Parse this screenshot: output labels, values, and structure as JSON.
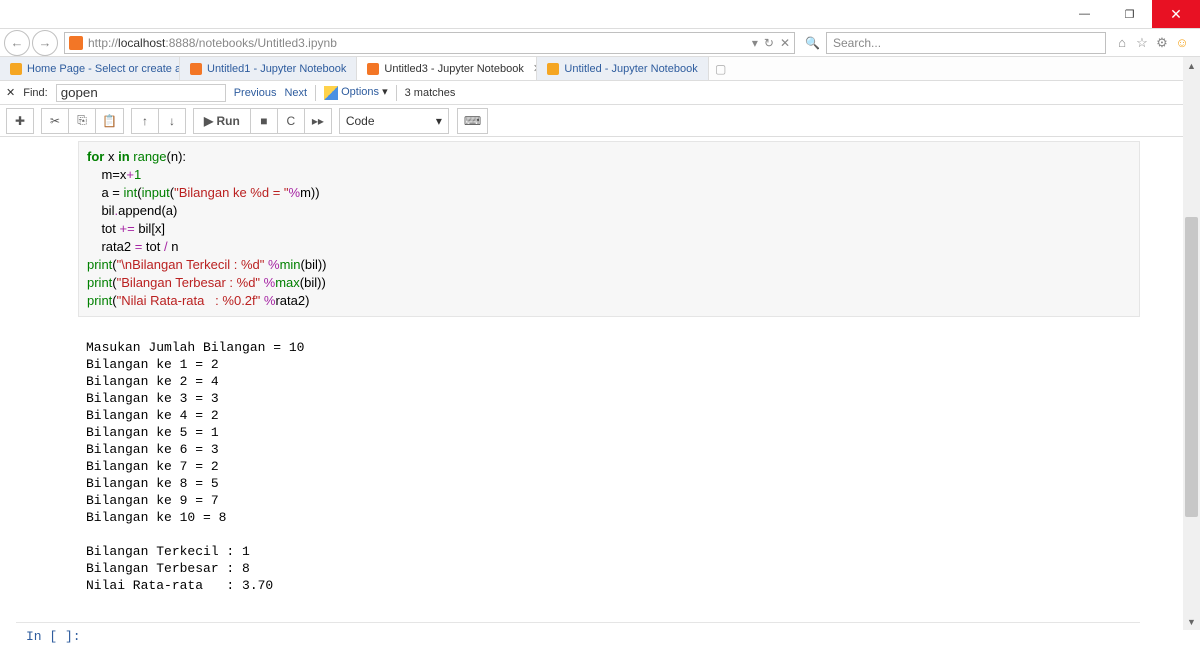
{
  "titlebar": {
    "min": "—",
    "max": "❐",
    "close": "✕"
  },
  "nav": {
    "back": "←",
    "fwd": "→"
  },
  "url": {
    "protocol": "http://",
    "host": "localhost",
    "port_path": ":8888/notebooks/Untitled3.ipynb",
    "refresh": "↻",
    "stop": "✕",
    "dd": "▾"
  },
  "search": {
    "placeholder": "Search...",
    "icon": "🔍"
  },
  "sysicons": {
    "home": "⌂",
    "fav": "☆",
    "gear": "⚙",
    "smile": "☺"
  },
  "tabs": [
    {
      "label": "Home Page - Select or create a...",
      "type": "dash"
    },
    {
      "label": "Untitled1 - Jupyter Notebook",
      "type": "jup"
    },
    {
      "label": "Untitled3 - Jupyter Notebook",
      "type": "jup",
      "active": true
    },
    {
      "label": "Untitled - Jupyter Notebook",
      "type": "dash"
    }
  ],
  "find": {
    "close": "✕",
    "label": "Find:",
    "value": "gopen",
    "prev": "Previous",
    "next": "Next",
    "options": "Options",
    "dd": "▾",
    "matches": "3 matches"
  },
  "toolbar": {
    "add": "✚",
    "cut": "✂",
    "copy": "⎘",
    "paste": "📋",
    "up": "↑",
    "down": "↓",
    "run": "▶ Run",
    "stop": "■",
    "restart": "C",
    "ff": "▸▸",
    "celltype": "Code",
    "dd": "▾",
    "keyb": "⌨"
  },
  "code": {
    "l1a": "for",
    "l1b": " x ",
    "l1c": "in",
    "l1d": " ",
    "l1e": "range",
    "l1f": "(n):",
    "l2": "    m=x",
    "l2op": "+",
    "l2n": "1",
    "l3a": "    a = ",
    "l3b": "int",
    "l3c": "(",
    "l3d": "input",
    "l3e": "(",
    "l3f": "\"Bilangan ke %d = \"",
    "l3g": "%",
    "l3h": "m))",
    "l4a": "    bil",
    "l4b": ".",
    "l4c": "append(a)",
    "l5a": "    tot ",
    "l5b": "+=",
    "l5c": " bil[x]",
    "l6a": "    rata2 ",
    "l6b": "=",
    "l6c": " tot ",
    "l6d": "/",
    "l6e": " n",
    "l7a": "print",
    "l7b": "(",
    "l7c": "\"\\nBilangan Terkecil : %d\"",
    "l7d": " %",
    "l7e": "min",
    "l7f": "(bil))",
    "l8a": "print",
    "l8b": "(",
    "l8c": "\"Bilangan Terbesar : %d\"",
    "l8d": " %",
    "l8e": "max",
    "l8f": "(bil))",
    "l9a": "print",
    "l9b": "(",
    "l9c": "\"Nilai Rata-rata   : %0.2f\"",
    "l9d": " %",
    "l9e": "rata2)"
  },
  "output": "Masukan Jumlah Bilangan = 10\nBilangan ke 1 = 2\nBilangan ke 2 = 4\nBilangan ke 3 = 3\nBilangan ke 4 = 2\nBilangan ke 5 = 1\nBilangan ke 6 = 3\nBilangan ke 7 = 2\nBilangan ke 8 = 5\nBilangan ke 9 = 7\nBilangan ke 10 = 8\n\nBilangan Terkecil : 1\nBilangan Terbesar : 8\nNilai Rata-rata   : 3.70",
  "prompt": "In [ ]:",
  "scroll": {
    "up": "▲",
    "down": "▼"
  }
}
